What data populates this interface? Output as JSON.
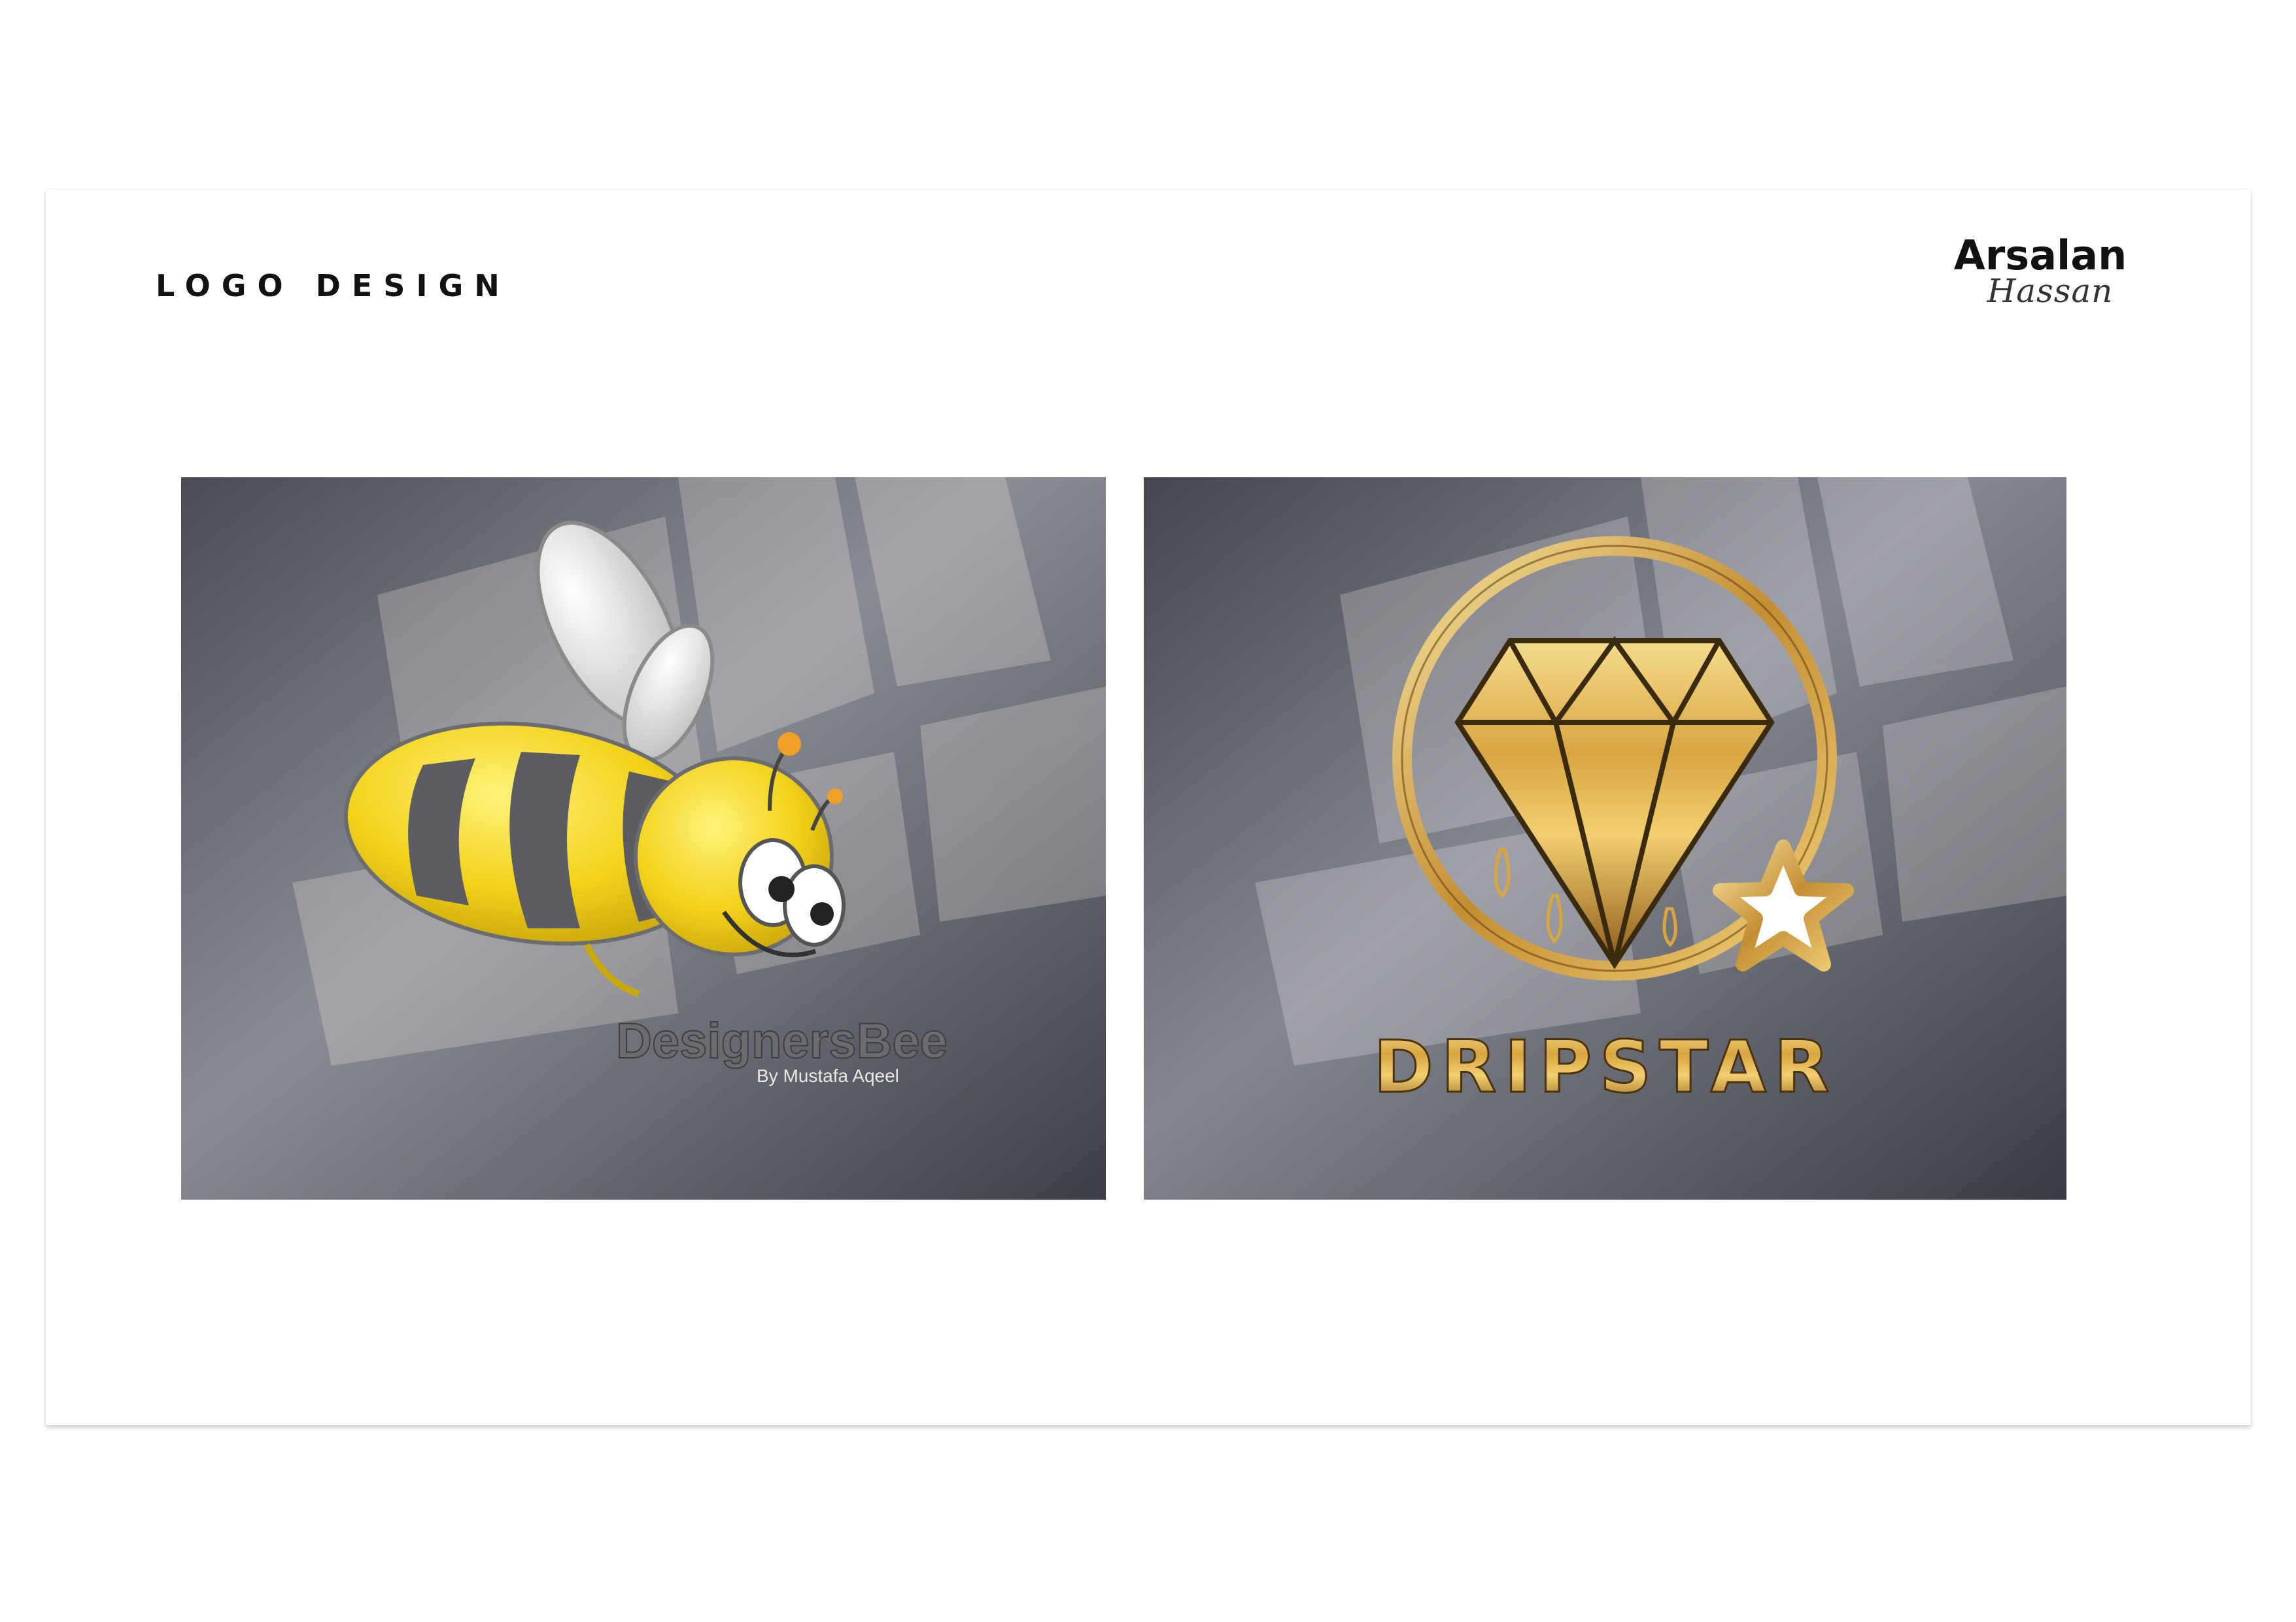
{
  "header": {
    "section_title": "LOGO DESIGN",
    "brand_first": "Arsalan",
    "brand_last": "Hassan"
  },
  "mockups": [
    {
      "logo_name": "DesignersBee",
      "tagline": "By Mustafa Aqeel",
      "icon": "bee-icon",
      "colors": {
        "body_yellow": "#f2d21a",
        "stripe_gray": "#5b5d62",
        "wing": "#e6e6e6"
      }
    },
    {
      "logo_name": "DRIPSTAR",
      "icon": "diamond-star-icon",
      "colors": {
        "gold": "#d8a640",
        "gold_light": "#f5dc8e",
        "gold_dark": "#8c5a17"
      }
    }
  ],
  "colors": {
    "wall_light": "#7d7f86",
    "wall_dark": "#3f4148"
  }
}
